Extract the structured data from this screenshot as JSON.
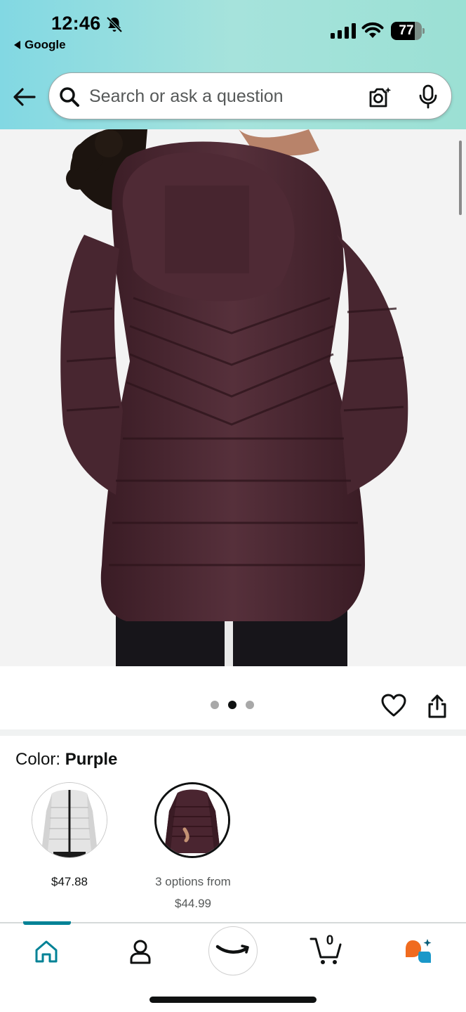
{
  "status_bar": {
    "time": "12:46",
    "back_app": "Google",
    "battery": "77",
    "battery_level": 0.77
  },
  "search": {
    "placeholder": "Search or ask a question"
  },
  "product": {
    "image_alt": "Purple hooded puffer jacket, back view",
    "carousel_dots": 3,
    "carousel_active_index": 1
  },
  "color_section": {
    "label": "Color: ",
    "selected_color": "Purple",
    "options": [
      {
        "name": "White",
        "price": "$47.88",
        "subtitle": ""
      },
      {
        "name": "Purple",
        "price": "$44.99",
        "subtitle": "3 options from"
      }
    ]
  },
  "bottom_nav": {
    "cart_count": "0",
    "items": [
      "home",
      "account",
      "amazon",
      "cart",
      "rufus"
    ]
  },
  "colors": {
    "header_start": "#82d8e3",
    "header_end": "#9be0d4",
    "accent_teal": "#008296",
    "jacket_purple": "#4a2530",
    "rufus_orange": "#f06b1f",
    "rufus_blue": "#1a98c9"
  }
}
